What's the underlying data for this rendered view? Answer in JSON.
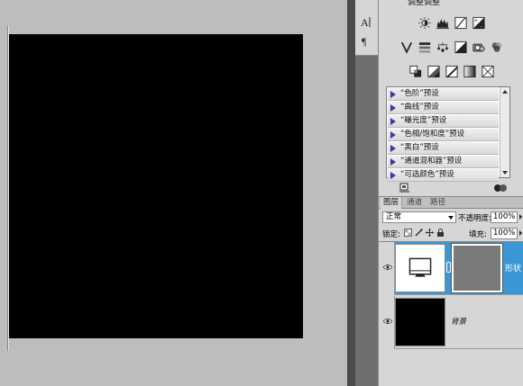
{
  "adjustments": {
    "title": "调整调整",
    "presets": [
      "“色阶”预设",
      "“曲线”预设",
      "“曝光度”预设",
      "“色相/饱和度”预设",
      "“黑白”预设",
      "“通道混和器”预设",
      "“可选颜色”预设"
    ],
    "icon_rows": [
      [
        "brightness-contrast-icon",
        "levels-icon",
        "curves-icon",
        "exposure-icon"
      ],
      [
        "vibrance-icon",
        "hue-saturation-icon",
        "color-balance-icon",
        "black-white-icon",
        "photo-filter-icon",
        "channel-mixer-icon"
      ],
      [
        "invert-icon",
        "posterize-icon",
        "threshold-icon",
        "gradient-map-icon",
        "selective-color-icon"
      ]
    ]
  },
  "layers": {
    "tabs": [
      "图层",
      "通道",
      "路径"
    ],
    "blend_mode": "正常",
    "opacity_label": "不透明度:",
    "opacity_value": "100%",
    "lock_label": "锁定:",
    "fill_label": "填充:",
    "fill_value": "100%",
    "items": [
      {
        "name": "形状",
        "selected": true
      },
      {
        "name": "背景",
        "selected": false
      }
    ]
  },
  "toolbar": {
    "tools": [
      "character-icon",
      "paragraph-icon"
    ]
  },
  "colors": {
    "selection": "#3a97d6",
    "canvas": "#000000",
    "workspace": "#bdbdbd",
    "panel": "#d6d6d6"
  }
}
